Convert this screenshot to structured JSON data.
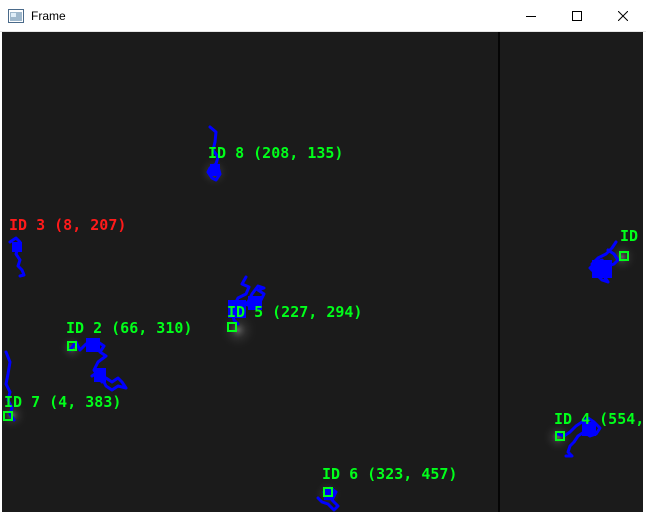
{
  "window": {
    "title": "Frame"
  },
  "titlebar_buttons": {
    "minimize_icon": "minimize-icon",
    "maximize_icon": "maximize-icon",
    "close_icon": "close-icon"
  },
  "colors": {
    "tracked_label": "#00ff1a",
    "lost_label": "#ff1a1a",
    "trail": "#0000ff",
    "background": "#1b1b1b"
  },
  "tracks": [
    {
      "label": "ID 8 (208, 135)",
      "status": "tracked"
    },
    {
      "label": "ID 3 (8, 207)",
      "status": "lost"
    },
    {
      "label": "ID",
      "status": "tracked"
    },
    {
      "label": "ID 5 (227, 294)",
      "status": "tracked"
    },
    {
      "label": "ID 2 (66, 310)",
      "status": "tracked"
    },
    {
      "label": "ID 7 (4, 383)",
      "status": "tracked"
    },
    {
      "label": "ID 4 (554,",
      "status": "tracked"
    },
    {
      "label": "ID 6 (323, 457)",
      "status": "tracked"
    }
  ]
}
